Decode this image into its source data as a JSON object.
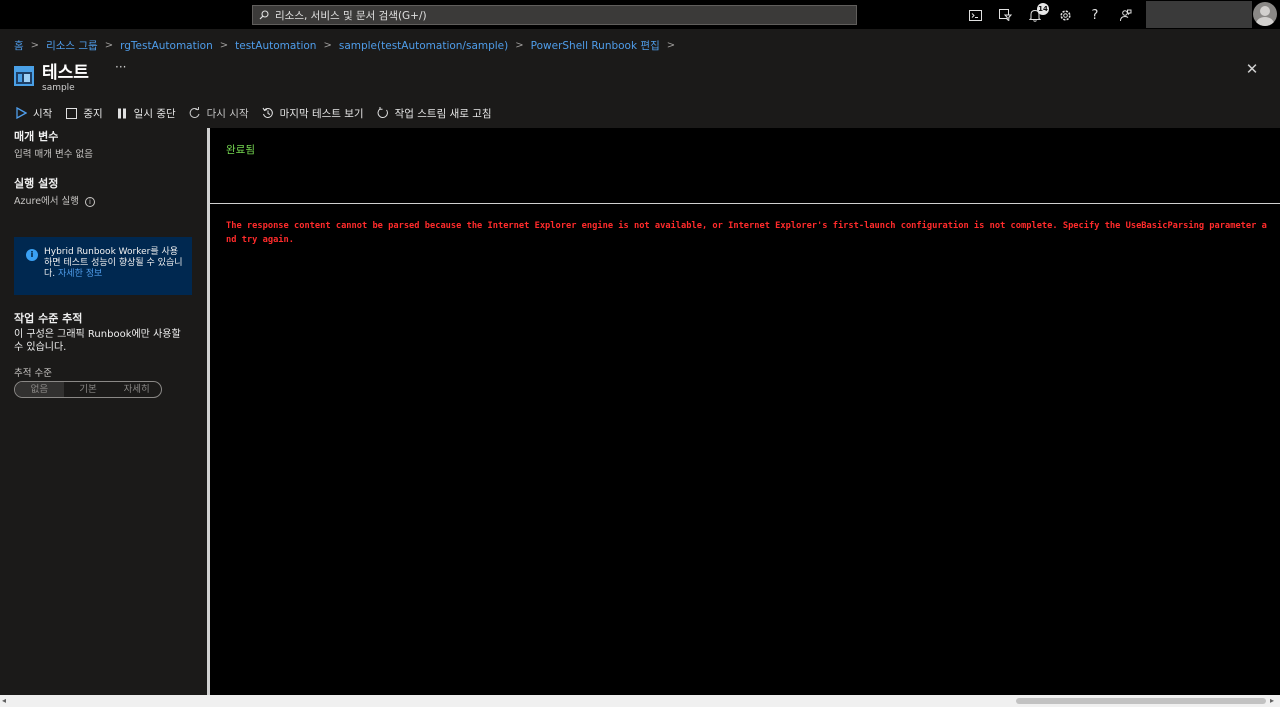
{
  "topbar": {
    "search_placeholder": "리소스, 서비스 및 문서 검색(G+/)",
    "notification_count": "14",
    "help_glyph": "?",
    "icons": [
      "cloud-shell-icon",
      "directory-filter-icon",
      "notifications-icon",
      "settings-icon",
      "help-icon",
      "feedback-icon"
    ]
  },
  "breadcrumb": [
    "홈",
    "리소스 그룹",
    "rgTestAutomation",
    "testAutomation",
    "sample(testAutomation/sample)",
    "PowerShell Runbook 편집"
  ],
  "header": {
    "title": "테스트",
    "subtitle": "sample",
    "more": "···",
    "close": "✕"
  },
  "toolbar": {
    "start": "시작",
    "stop": "중지",
    "pause": "일시 중단",
    "resume": "다시 시작",
    "last_test": "마지막 테스트 보기",
    "refresh": "작업 스트림 새로 고침"
  },
  "left_panel": {
    "params_heading": "매개 변수",
    "params_text": "입력 매개 변수 없음",
    "run_heading": "실행 설정",
    "run_text": "Azure에서 실행",
    "info_text": "Hybrid Runbook Worker를 사용하면 테스트 성능이 향상될 수 있습니다.",
    "info_link": "자세한 정보",
    "trace_heading": "작업 수준 추적",
    "trace_text": "이 구성은 그래픽 Runbook에만 사용할 수 있습니다.",
    "trace_level_label": "추적 수준",
    "trace_options": [
      "없음",
      "기본",
      "자세히"
    ],
    "trace_selected": "없음"
  },
  "output": {
    "status": "완료됨",
    "error": "The response content cannot be parsed because the Internet Explorer engine is not available, or Internet Explorer's first-launch configuration is not complete. Specify the UseBasicParsing parameter and try again."
  },
  "colors": {
    "link": "#4f9dea",
    "status_ok": "#74d650",
    "error": "#ff2b2b",
    "info_bg": "#002850"
  }
}
